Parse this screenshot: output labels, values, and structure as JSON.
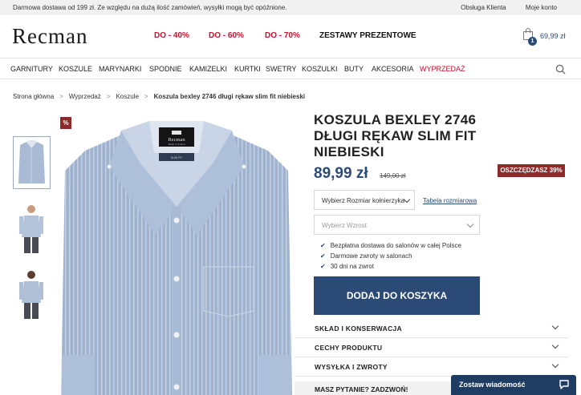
{
  "topbar": {
    "notice": "Darmowa dostawa od 199 zł. Ze względu na dużą ilość zamówień, wysyłki mogą być opóźnione.",
    "customer_service": "Obsługa Klienta",
    "account": "Moje konto"
  },
  "header": {
    "logo": "Recman",
    "promos": [
      "DO - 40%",
      "DO - 60%",
      "DO - 70%"
    ],
    "gift_sets": "ZESTAWY PREZENTOWE",
    "cart_count": "1",
    "cart_total": "69,99 zł"
  },
  "nav": {
    "items": [
      "GARNITURY",
      "KOSZULE",
      "MARYNARKI",
      "SPODNIE",
      "KAMIZELKI",
      "KURTKI",
      "SWETRY",
      "KOSZULKI",
      "BUTY",
      "AKCESORIA"
    ],
    "sale": "WYPRZEDAŻ"
  },
  "breadcrumb": {
    "items": [
      "Strona główna",
      "Wyprzedaż",
      "Koszule"
    ],
    "current": "Koszula bexley 2746 długi rękaw slim fit niebieski",
    "separator": ">"
  },
  "gallery": {
    "discount_tag": "%",
    "label_brand": "Recman",
    "label_sub": "Made in Poland",
    "label_fit": "SLIM FIT"
  },
  "product": {
    "title": "KOSZULA BEXLEY 2746 DŁUGI RĘKAW SLIM FIT NIEBIESKI",
    "price": "89,99 zł",
    "old_price": "149,00 zł",
    "save_badge": "OSZCZĘDZASZ 39%",
    "size_placeholder": "Wybierz Rozmiar kołnierzyka",
    "size_chart": "Tabela rozmiarowa",
    "height_placeholder": "Wybierz Wzrost",
    "benefits": [
      "Bezpłatna dostawa do salonów w całej Polsce",
      "Darmowe zwroty w salonach",
      "30 dni na zwrot"
    ],
    "add_to_cart": "DODAJ DO KOSZYKA"
  },
  "accordions": [
    "SKŁAD I KONSERWACJA",
    "CECHY PRODUKTU",
    "WYSYŁKA I ZWROTY"
  ],
  "question": "MASZ PYTANIE? ZADZWOŃ!",
  "chat": {
    "label": "Zostaw wiadomość"
  },
  "colors": {
    "brand_blue": "#2c4a76",
    "sale_red": "#c8102e",
    "badge_red": "#8e2a2a",
    "chat_blue": "#1f3c63"
  }
}
